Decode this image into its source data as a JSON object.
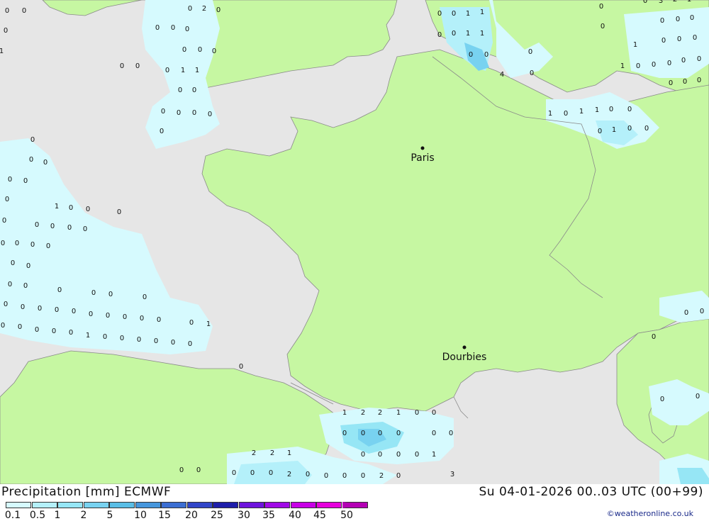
{
  "header": {
    "title": "Precipitation [mm] ECMWF",
    "datetime": "Su 04-01-2026 00..03 UTC (00+99)"
  },
  "legend": {
    "ticks": [
      "0.1",
      "0.5",
      "1",
      "2",
      "5",
      "10",
      "15",
      "20",
      "25",
      "30",
      "35",
      "40",
      "45",
      "50"
    ],
    "colors": [
      "#d6fafe",
      "#b4f0fa",
      "#96e6f5",
      "#78d2f0",
      "#5abee6",
      "#4696dc",
      "#3c6ed2",
      "#3246c8",
      "#1e1eaa",
      "#6e14dc",
      "#a00ae6",
      "#c800e6",
      "#e600dc",
      "#b400b4"
    ]
  },
  "map": {
    "cities": [
      {
        "name": "Paris"
      },
      {
        "name": "Dourbies"
      }
    ],
    "values": [
      "0",
      "0",
      "0",
      "2",
      "0",
      "0",
      "0",
      "0",
      "0",
      "1",
      "0",
      "0",
      "0",
      "0",
      "0",
      "0",
      "1",
      "1",
      "0",
      "0",
      "0",
      "0",
      "0",
      "0",
      "0",
      "0",
      "0",
      "0",
      "0",
      "0",
      "0",
      "1",
      "0",
      "0",
      "0",
      "0",
      "0",
      "0",
      "0",
      "0",
      "0",
      "0",
      "0",
      "0",
      "0",
      "0",
      "0",
      "0",
      "0",
      "0",
      "0",
      "0",
      "0",
      "0",
      "0",
      "0",
      "0",
      "0",
      "0",
      "0",
      "0",
      "0",
      "1",
      "0",
      "0",
      "0",
      "0",
      "0",
      "0",
      "0",
      "0",
      "1",
      "0",
      "0",
      "0",
      "0",
      "0",
      "0",
      "0",
      "1",
      "1",
      "0",
      "0",
      "1",
      "1",
      "0",
      "0",
      "4",
      "0",
      "0",
      "0",
      "0",
      "1",
      "0",
      "1",
      "1",
      "0",
      "0",
      "0",
      "1",
      "0",
      "0",
      "3",
      "2",
      "0",
      "1",
      "0",
      "0",
      "0",
      "0",
      "0",
      "0",
      "1",
      "1",
      "0",
      "0",
      "0",
      "0",
      "0",
      "0",
      "0",
      "0",
      "0",
      "0",
      "0",
      "0",
      "0",
      "1",
      "2",
      "2",
      "1",
      "0",
      "0",
      "0",
      "0",
      "0",
      "0",
      "0",
      "0",
      "0",
      "0",
      "0",
      "0",
      "1",
      "2",
      "2",
      "1",
      "0",
      "0",
      "0",
      "0",
      "0",
      "2",
      "0",
      "0",
      "0",
      "0",
      "2",
      "0",
      "3"
    ]
  },
  "footer": {
    "credit": "©weatheronline.co.uk"
  },
  "colors": {
    "land": "#c6f7a2",
    "sea": "#e6e6e6",
    "border": "#8a8a8a"
  }
}
